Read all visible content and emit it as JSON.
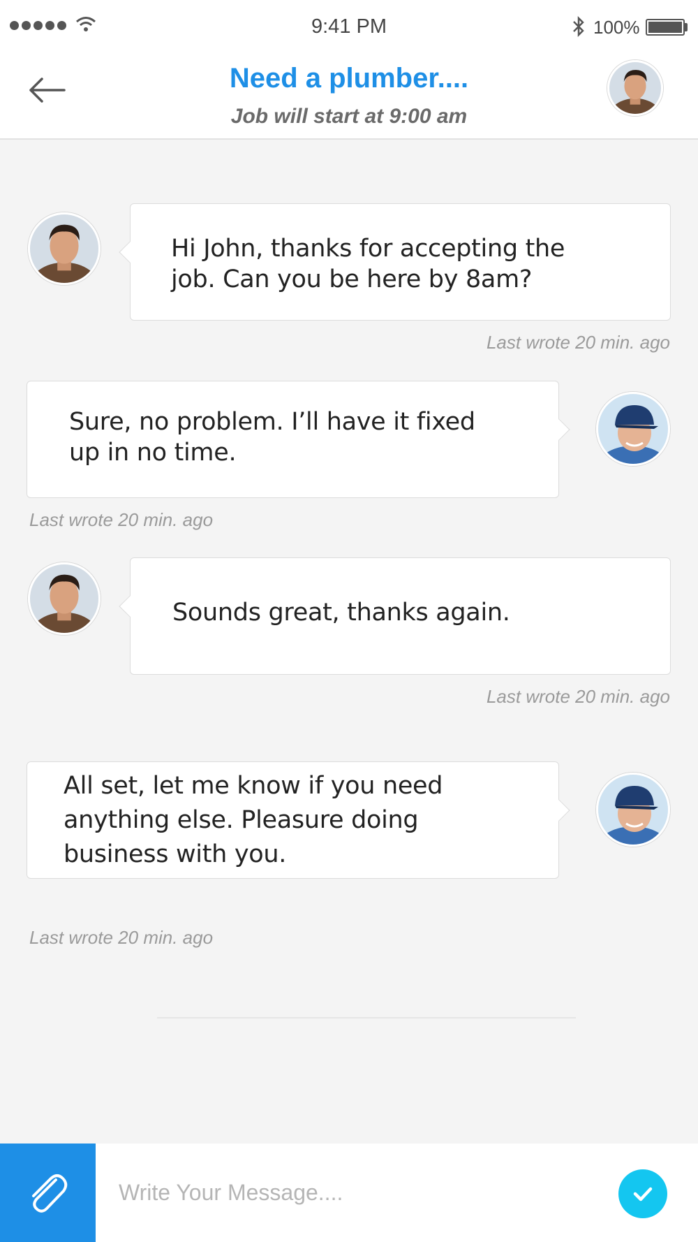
{
  "status_bar": {
    "time": "9:41 PM",
    "battery": "100%",
    "signal_icon": "signal-dots-icon",
    "wifi_icon": "wifi-icon",
    "bluetooth_icon": "bluetooth-icon"
  },
  "header": {
    "title": "Need a plumber....",
    "subtitle": "Job will start at 9:00 am",
    "back_icon": "arrow-left-icon"
  },
  "messages": [
    {
      "sender": "client",
      "text": "Hi John, thanks for accepting the job. Can you be here by 8am?",
      "meta": "Last wrote 20 min. ago"
    },
    {
      "sender": "plumber",
      "text": "Sure, no problem. I’ll have it fixed up in no time.",
      "meta": "Last wrote 20 min. ago"
    },
    {
      "sender": "client",
      "text": "Sounds great, thanks again.",
      "meta": "Last wrote 20 min. ago"
    },
    {
      "sender": "plumber",
      "text": "All set, let me know if you need anything else. Pleasure doing business with you.",
      "meta": "Last wrote 20 min. ago"
    }
  ],
  "composer": {
    "placeholder": "Write Your Message....",
    "attach_icon": "paperclip-icon",
    "send_icon": "checkmark-icon"
  },
  "colors": {
    "accent": "#1e8fe6",
    "send": "#14c6f0",
    "background": "#f4f4f4"
  }
}
